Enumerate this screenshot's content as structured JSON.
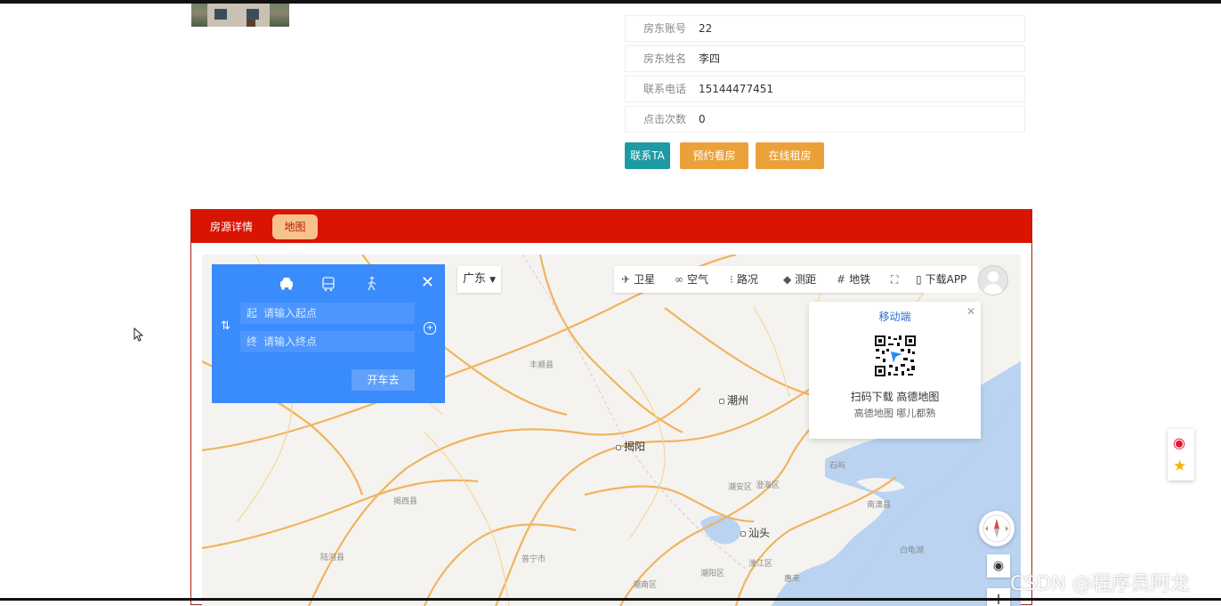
{
  "house": {
    "info": [
      {
        "label": "房东账号",
        "value": "22"
      },
      {
        "label": "房东姓名",
        "value": "李四"
      },
      {
        "label": "联系电话",
        "value": "15144477451"
      },
      {
        "label": "点击次数",
        "value": "0"
      }
    ],
    "buttons": {
      "contact": "联系TA",
      "book": "预约看房",
      "rent": "在线租房"
    }
  },
  "tabs": {
    "detail": "房源详情",
    "map": "地图"
  },
  "map": {
    "route": {
      "start_prefix": "起",
      "start_placeholder": "请输入起点",
      "end_prefix": "终",
      "end_placeholder": "请输入终点",
      "go": "开车去",
      "swap": "⇅",
      "plus": "+"
    },
    "province": "广东",
    "tools": {
      "satellite": "卫星",
      "air": "空气",
      "traffic": "路况",
      "measure": "测距",
      "subway": "地铁",
      "download": "下载APP"
    },
    "qr": {
      "title": "移动端",
      "line1": "扫码下载 高德地图",
      "line2": "高德地图 哪儿都熟"
    },
    "cities": {
      "chaozhou": "潮州",
      "jieyang": "揭阳",
      "shantou": "汕头"
    },
    "towns": {
      "fengshun": "丰顺县",
      "jiexi": "揭西县",
      "luhe": "陆河县",
      "puning": "普宁市",
      "chaoyang": "潮阳区",
      "chaonan": "潮南区",
      "chaoan": "潮安区",
      "haojiang": "濠江区",
      "chenghai": "澄海区",
      "nanao": "南澳县",
      "huilai": "惠来",
      "baiguishan": "白龟湖",
      "shidi": "石屿"
    }
  },
  "watermark": "CSDN @程序员阿龙",
  "colors": {
    "tabbar": "#d91400",
    "route_panel": "#3a8bfb",
    "contact": "#1e9aa3",
    "orange": "#eba13a"
  }
}
